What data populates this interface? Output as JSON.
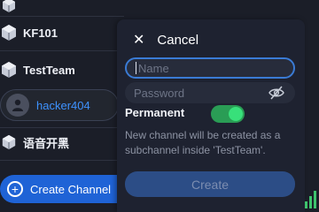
{
  "channels": [
    {
      "label": "KF101",
      "icon": "cube-icon"
    },
    {
      "label": "TestTeam",
      "icon": "cube-icon"
    },
    {
      "label": "语音开黑",
      "icon": "cube-icon"
    }
  ],
  "user": {
    "name": "hacker404",
    "icon": "person-icon"
  },
  "create_channel_label": "Create Channel",
  "dialog": {
    "cancel_label": "Cancel",
    "name_placeholder": "Name",
    "password_placeholder": "Password",
    "permanent_label": "Permanent",
    "permanent_on": true,
    "hint": "New channel will be created as a subchannel inside 'TestTeam'.",
    "submit_label": "Create"
  },
  "colors": {
    "accent": "#1f63d6",
    "link": "#3e92ff",
    "toggle_on": "#38e07a",
    "background": "#1b1e28",
    "panel": "#1e2230"
  }
}
